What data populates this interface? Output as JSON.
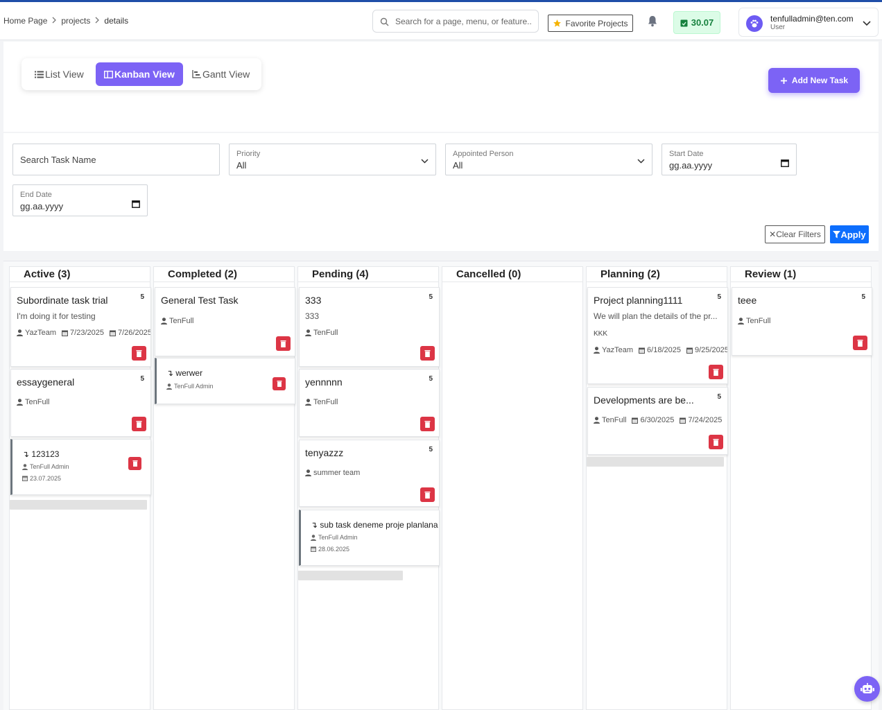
{
  "breadcrumb": [
    "Home Page",
    "projects",
    "details"
  ],
  "header": {
    "search_placeholder": "Search for a page, menu, or feature..",
    "favorite_label": "Favorite Projects",
    "credit": "30.07",
    "user_email": "tenfulladmin@ten.com",
    "user_role": "User"
  },
  "views": {
    "list": "List View",
    "kanban": "Kanban View",
    "gantt": "Gantt View",
    "active": "kanban"
  },
  "add_task_label": "Add New Task",
  "filters": {
    "search_label": "Search Task Name",
    "priority_label": "Priority",
    "priority_value": "All",
    "person_label": "Appointed Person",
    "person_value": "All",
    "start_label": "Start Date",
    "start_value": "gg.aa.yyyy",
    "end_label": "End Date",
    "end_value": "gg.aa.yyyy",
    "clear_label": "Clear Filters",
    "apply_label": "Apply"
  },
  "columns": [
    {
      "title": "Active (3)",
      "cards": [
        {
          "title": "Subordinate task trial",
          "num": "5",
          "desc": "I'm doing it for testing",
          "person": "YazTeam",
          "start": "7/23/2025",
          "end": "7/26/2025"
        },
        {
          "title": "essaygeneral",
          "num": "5",
          "person": "TenFull"
        }
      ],
      "subtasks": [
        {
          "title": "123123",
          "person": "TenFull Admin",
          "date": "23.07.2025"
        }
      ]
    },
    {
      "title": "Completed (2)",
      "cards": [
        {
          "title": "General Test Task",
          "person": "TenFull"
        }
      ],
      "subtasks": [
        {
          "title": "werwer",
          "person": "TenFull Admin"
        }
      ]
    },
    {
      "title": "Pending (4)",
      "cards": [
        {
          "title": "333",
          "num": "5",
          "desc": "333",
          "person": "TenFull"
        },
        {
          "title": "yennnnn",
          "num": "5",
          "person": "TenFull"
        },
        {
          "title": "tenyazzz",
          "num": "5",
          "person": "summer team"
        }
      ],
      "subtasks": [
        {
          "title": "sub task deneme proje planlana",
          "person": "TenFull Admin",
          "date": "28.06.2025"
        }
      ]
    },
    {
      "title": "Cancelled (0)",
      "cards": [],
      "subtasks": []
    },
    {
      "title": "Planning (2)",
      "cards": [
        {
          "title": "Project planning1111",
          "num": "5",
          "desc": "We will plan the details of the pr...",
          "tag": "KKK",
          "person": "YazTeam",
          "start": "6/18/2025",
          "end": "9/25/2025"
        },
        {
          "title": "Developments are be...",
          "num": "5",
          "person": "TenFull",
          "start": "6/30/2025",
          "end": "7/24/2025"
        }
      ],
      "subtasks": []
    },
    {
      "title": "Review (1)",
      "cards": [
        {
          "title": "teee",
          "num": "5",
          "person": "TenFull"
        }
      ],
      "subtasks": []
    }
  ],
  "colors": {
    "accent": "#7c63f5",
    "danger": "#dc3545",
    "primary": "#0d6efd",
    "credit_bg": "#dcfce7"
  }
}
